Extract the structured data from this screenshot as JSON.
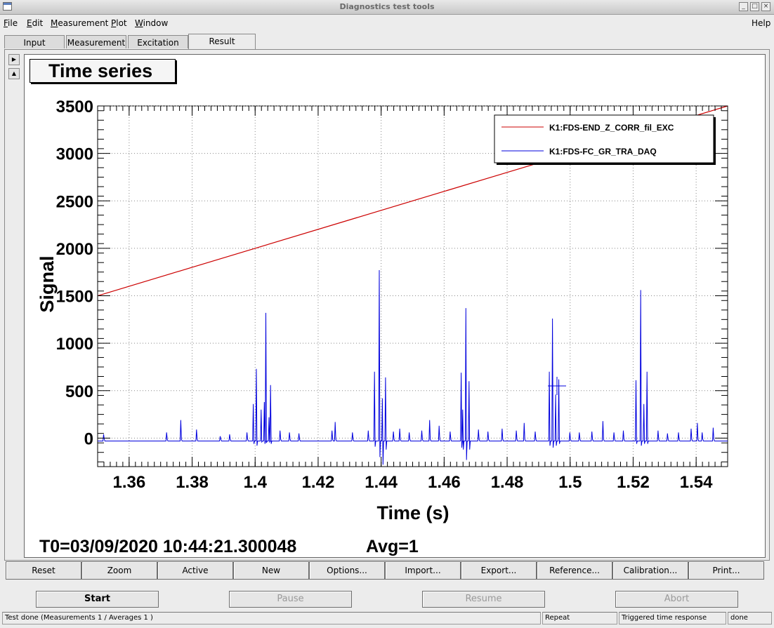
{
  "window": {
    "title": "Diagnostics test tools"
  },
  "menu": [
    "File",
    "Edit",
    "Measurement",
    "Plot",
    "Window"
  ],
  "menu_underline": [
    "F",
    "E",
    "M",
    "P",
    "W"
  ],
  "menu_help": "Help",
  "tabs": [
    "Input",
    "Measurement",
    "Excitation",
    "Result"
  ],
  "active_tab": "Result",
  "plot": {
    "title": "Time series",
    "t0_label": "T0=03/09/2020 10:44:21.300048",
    "avg_label": "Avg=1"
  },
  "chart_data": {
    "type": "line",
    "xlabel": "Time (s)",
    "ylabel": "Signal",
    "xlim": [
      1.35,
      1.55
    ],
    "ylim": [
      -300,
      3500
    ],
    "x_ticks": [
      "1.36",
      "1.38",
      "1.4",
      "1.42",
      "1.44",
      "1.46",
      "1.48",
      "1.5",
      "1.52",
      "1.54"
    ],
    "x_tick_values": [
      1.36,
      1.38,
      1.4,
      1.42,
      1.44,
      1.46,
      1.48,
      1.5,
      1.52,
      1.54
    ],
    "y_ticks": [
      "0",
      "500",
      "1000",
      "1500",
      "2000",
      "2500",
      "3000",
      "3500"
    ],
    "y_tick_values": [
      0,
      500,
      1000,
      1500,
      2000,
      2500,
      3000,
      3500
    ],
    "grid": true,
    "legend_position": "top-right",
    "series": [
      {
        "name": "K1:FDS-END_Z_CORR_fil_EXC",
        "color": "#cc0000",
        "x": [
          1.35,
          1.55
        ],
        "y": [
          1500,
          3500
        ]
      },
      {
        "name": "K1:FDS-FC_GR_TRA_DAQ",
        "color": "#0000dd",
        "baseline": -30,
        "spikes": [
          {
            "x": 1.352,
            "y": 40,
            "neg": -10
          },
          {
            "x": 1.372,
            "y": 60,
            "neg": -10
          },
          {
            "x": 1.3765,
            "y": 190,
            "neg": -10
          },
          {
            "x": 1.3815,
            "y": 90,
            "neg": -10
          },
          {
            "x": 1.389,
            "y": 20,
            "neg": -10
          },
          {
            "x": 1.392,
            "y": 40,
            "neg": -10
          },
          {
            "x": 1.3975,
            "y": 60,
            "neg": -10
          },
          {
            "x": 1.3995,
            "y": 360,
            "neg": -60
          },
          {
            "x": 1.4005,
            "y": 730,
            "neg": -80
          },
          {
            "x": 1.402,
            "y": 300,
            "neg": -40
          },
          {
            "x": 1.403,
            "y": 380,
            "neg": -60
          },
          {
            "x": 1.4035,
            "y": 1320,
            "neg": -50
          },
          {
            "x": 1.4045,
            "y": 220,
            "neg": -40
          },
          {
            "x": 1.405,
            "y": 560,
            "neg": -60
          },
          {
            "x": 1.408,
            "y": 80,
            "neg": -10
          },
          {
            "x": 1.411,
            "y": 60,
            "neg": -10
          },
          {
            "x": 1.414,
            "y": 50,
            "neg": -10
          },
          {
            "x": 1.4245,
            "y": 80,
            "neg": -10
          },
          {
            "x": 1.4255,
            "y": 170,
            "neg": -10
          },
          {
            "x": 1.431,
            "y": 60,
            "neg": -10
          },
          {
            "x": 1.436,
            "y": 80,
            "neg": -10
          },
          {
            "x": 1.438,
            "y": 700,
            "neg": -90
          },
          {
            "x": 1.4395,
            "y": 1770,
            "neg": -200
          },
          {
            "x": 1.4405,
            "y": 420,
            "neg": -280
          },
          {
            "x": 1.4415,
            "y": 640,
            "neg": -120
          },
          {
            "x": 1.444,
            "y": 70,
            "neg": -10
          },
          {
            "x": 1.446,
            "y": 100,
            "neg": -10
          },
          {
            "x": 1.449,
            "y": 60,
            "neg": -10
          },
          {
            "x": 1.453,
            "y": 80,
            "neg": -10
          },
          {
            "x": 1.4555,
            "y": 190,
            "neg": -10
          },
          {
            "x": 1.4585,
            "y": 130,
            "neg": -10
          },
          {
            "x": 1.462,
            "y": 70,
            "neg": -10
          },
          {
            "x": 1.4655,
            "y": 690,
            "neg": -100
          },
          {
            "x": 1.466,
            "y": 300,
            "neg": -120
          },
          {
            "x": 1.467,
            "y": 1370,
            "neg": -230
          },
          {
            "x": 1.468,
            "y": 600,
            "neg": -120
          },
          {
            "x": 1.471,
            "y": 90,
            "neg": -10
          },
          {
            "x": 1.474,
            "y": 70,
            "neg": -10
          },
          {
            "x": 1.4785,
            "y": 100,
            "neg": -10
          },
          {
            "x": 1.483,
            "y": 80,
            "neg": -10
          },
          {
            "x": 1.4855,
            "y": 160,
            "neg": -10
          },
          {
            "x": 1.489,
            "y": 70,
            "neg": -10
          },
          {
            "x": 1.4935,
            "y": 700,
            "neg": -80
          },
          {
            "x": 1.4945,
            "y": 1260,
            "neg": -100
          },
          {
            "x": 1.4955,
            "y": 460,
            "neg": -80
          },
          {
            "x": 1.4965,
            "y": 620,
            "neg": -60
          },
          {
            "x": 1.5,
            "y": 60,
            "neg": -10
          },
          {
            "x": 1.503,
            "y": 60,
            "neg": -10
          },
          {
            "x": 1.507,
            "y": 70,
            "neg": -10
          },
          {
            "x": 1.5105,
            "y": 180,
            "neg": -10
          },
          {
            "x": 1.514,
            "y": 60,
            "neg": -10
          },
          {
            "x": 1.517,
            "y": 80,
            "neg": -10
          },
          {
            "x": 1.521,
            "y": 610,
            "neg": -60
          },
          {
            "x": 1.5225,
            "y": 1560,
            "neg": -80
          },
          {
            "x": 1.5235,
            "y": 360,
            "neg": -60
          },
          {
            "x": 1.5245,
            "y": 700,
            "neg": -60
          },
          {
            "x": 1.528,
            "y": 80,
            "neg": -10
          },
          {
            "x": 1.531,
            "y": 50,
            "neg": -10
          },
          {
            "x": 1.5345,
            "y": 60,
            "neg": -10
          },
          {
            "x": 1.5385,
            "y": 100,
            "neg": -10
          },
          {
            "x": 1.5405,
            "y": 160,
            "neg": -10
          },
          {
            "x": 1.542,
            "y": 60,
            "neg": -10
          },
          {
            "x": 1.5455,
            "y": 110,
            "neg": -10
          }
        ]
      }
    ]
  },
  "plot_buttons": [
    "Reset",
    "Zoom",
    "Active",
    "New",
    "Options...",
    "Import...",
    "Export...",
    "Reference...",
    "Calibration...",
    "Print..."
  ],
  "controls": {
    "start": "Start",
    "pause": "Pause",
    "resume": "Resume",
    "abort": "Abort"
  },
  "status": {
    "message": "Test done (Measurements 1 / Averages 1 )",
    "repeat": "Repeat",
    "mode": "Triggered time response",
    "state": "done"
  }
}
